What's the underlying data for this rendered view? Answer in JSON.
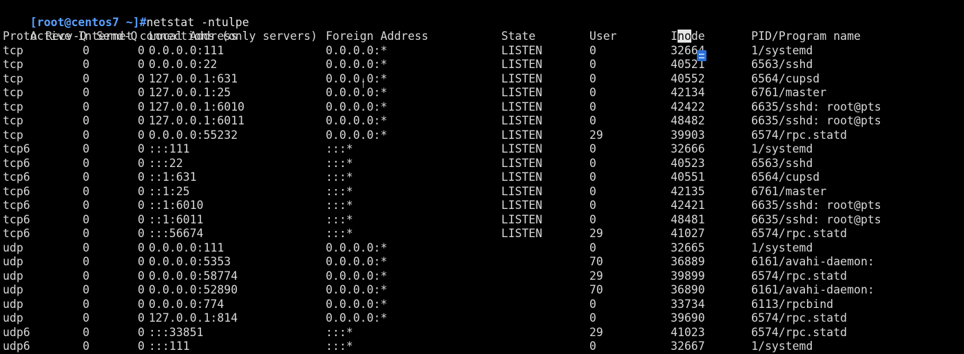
{
  "prompt": "[root@centos7 ~]#",
  "command": "netstat -ntulpe",
  "title_line": "Active Internet connections (only servers)",
  "headers": {
    "proto": "Proto",
    "recv": "Recv-Q",
    "send": "Send-Q",
    "local": "Local Address",
    "foreign": "Foreign Address",
    "state": "State",
    "user": "User",
    "inode_pre": "I",
    "inode_hl": "no",
    "inode_post": "de",
    "pid": "PID/Program name"
  },
  "rows": [
    {
      "proto": "tcp",
      "recv": "0",
      "send": "0",
      "local": "0.0.0.0:111",
      "foreign": "0.0.0.0:*",
      "state": "LISTEN",
      "user": "0",
      "inode": "32664",
      "pid": "1/systemd"
    },
    {
      "proto": "tcp",
      "recv": "0",
      "send": "0",
      "local": "0.0.0.0:22",
      "foreign": "0.0.0.0:*",
      "state": "LISTEN",
      "user": "0",
      "inode": "40521",
      "pid": "6563/sshd"
    },
    {
      "proto": "tcp",
      "recv": "0",
      "send": "0",
      "local": "127.0.0.1:631",
      "foreign": "0.0.0.0:*",
      "state": "LISTEN",
      "user": "0",
      "inode": "40552",
      "pid": "6564/cupsd"
    },
    {
      "proto": "tcp",
      "recv": "0",
      "send": "0",
      "local": "127.0.0.1:25",
      "foreign": "0.0.0.0:*",
      "state": "LISTEN",
      "user": "0",
      "inode": "42134",
      "pid": "6761/master"
    },
    {
      "proto": "tcp",
      "recv": "0",
      "send": "0",
      "local": "127.0.0.1:6010",
      "foreign": "0.0.0.0:*",
      "state": "LISTEN",
      "user": "0",
      "inode": "42422",
      "pid": "6635/sshd: root@pts"
    },
    {
      "proto": "tcp",
      "recv": "0",
      "send": "0",
      "local": "127.0.0.1:6011",
      "foreign": "0.0.0.0:*",
      "state": "LISTEN",
      "user": "0",
      "inode": "48482",
      "pid": "6635/sshd: root@pts"
    },
    {
      "proto": "tcp",
      "recv": "0",
      "send": "0",
      "local": "0.0.0.0:55232",
      "foreign": "0.0.0.0:*",
      "state": "LISTEN",
      "user": "29",
      "inode": "39903",
      "pid": "6574/rpc.statd"
    },
    {
      "proto": "tcp6",
      "recv": "0",
      "send": "0",
      "local": ":::111",
      "foreign": ":::*",
      "state": "LISTEN",
      "user": "0",
      "inode": "32666",
      "pid": "1/systemd"
    },
    {
      "proto": "tcp6",
      "recv": "0",
      "send": "0",
      "local": ":::22",
      "foreign": ":::*",
      "state": "LISTEN",
      "user": "0",
      "inode": "40523",
      "pid": "6563/sshd"
    },
    {
      "proto": "tcp6",
      "recv": "0",
      "send": "0",
      "local": "::1:631",
      "foreign": ":::*",
      "state": "LISTEN",
      "user": "0",
      "inode": "40551",
      "pid": "6564/cupsd"
    },
    {
      "proto": "tcp6",
      "recv": "0",
      "send": "0",
      "local": "::1:25",
      "foreign": ":::*",
      "state": "LISTEN",
      "user": "0",
      "inode": "42135",
      "pid": "6761/master"
    },
    {
      "proto": "tcp6",
      "recv": "0",
      "send": "0",
      "local": "::1:6010",
      "foreign": ":::*",
      "state": "LISTEN",
      "user": "0",
      "inode": "42421",
      "pid": "6635/sshd: root@pts"
    },
    {
      "proto": "tcp6",
      "recv": "0",
      "send": "0",
      "local": "::1:6011",
      "foreign": ":::*",
      "state": "LISTEN",
      "user": "0",
      "inode": "48481",
      "pid": "6635/sshd: root@pts"
    },
    {
      "proto": "tcp6",
      "recv": "0",
      "send": "0",
      "local": ":::56674",
      "foreign": ":::*",
      "state": "LISTEN",
      "user": "29",
      "inode": "41027",
      "pid": "6574/rpc.statd"
    },
    {
      "proto": "udp",
      "recv": "0",
      "send": "0",
      "local": "0.0.0.0:111",
      "foreign": "0.0.0.0:*",
      "state": "",
      "user": "0",
      "inode": "32665",
      "pid": "1/systemd"
    },
    {
      "proto": "udp",
      "recv": "0",
      "send": "0",
      "local": "0.0.0.0:5353",
      "foreign": "0.0.0.0:*",
      "state": "",
      "user": "70",
      "inode": "36889",
      "pid": "6161/avahi-daemon:"
    },
    {
      "proto": "udp",
      "recv": "0",
      "send": "0",
      "local": "0.0.0.0:58774",
      "foreign": "0.0.0.0:*",
      "state": "",
      "user": "29",
      "inode": "39899",
      "pid": "6574/rpc.statd"
    },
    {
      "proto": "udp",
      "recv": "0",
      "send": "0",
      "local": "0.0.0.0:52890",
      "foreign": "0.0.0.0:*",
      "state": "",
      "user": "70",
      "inode": "36890",
      "pid": "6161/avahi-daemon:"
    },
    {
      "proto": "udp",
      "recv": "0",
      "send": "0",
      "local": "0.0.0.0:774",
      "foreign": "0.0.0.0:*",
      "state": "",
      "user": "0",
      "inode": "33734",
      "pid": "6113/rpcbind"
    },
    {
      "proto": "udp",
      "recv": "0",
      "send": "0",
      "local": "127.0.0.1:814",
      "foreign": "0.0.0.0:*",
      "state": "",
      "user": "0",
      "inode": "39690",
      "pid": "6574/rpc.statd"
    },
    {
      "proto": "udp6",
      "recv": "0",
      "send": "0",
      "local": ":::33851",
      "foreign": ":::*",
      "state": "",
      "user": "29",
      "inode": "41023",
      "pid": "6574/rpc.statd"
    },
    {
      "proto": "udp6",
      "recv": "0",
      "send": "0",
      "local": ":::111",
      "foreign": ":::*",
      "state": "",
      "user": "0",
      "inode": "32667",
      "pid": "1/systemd"
    }
  ],
  "colors": {
    "background": "#000000",
    "text": "#d8d8d8",
    "prompt": "#5aa0ff"
  },
  "icons": {
    "cursor": "text-cursor-icon",
    "selection_marker": "selection-marker-icon"
  }
}
